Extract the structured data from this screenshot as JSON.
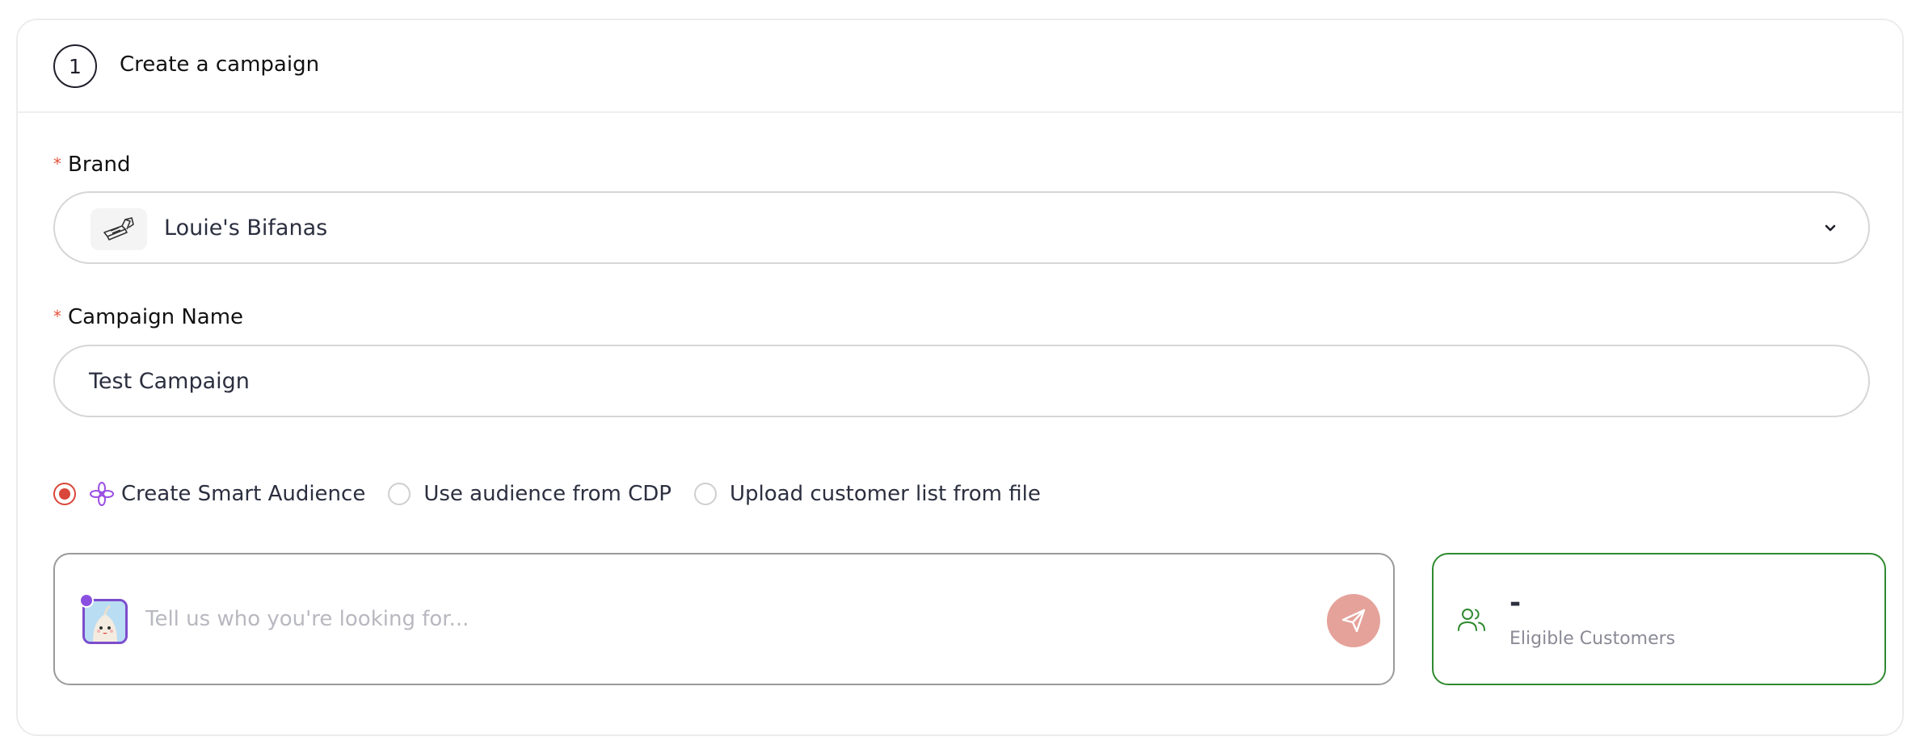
{
  "header": {
    "step_number": "1",
    "title": "Create a campaign"
  },
  "brand": {
    "label": "Brand",
    "required_mark": "*",
    "selected": "Louie's Bifanas",
    "logo_icon": "sandwich-logo-icon"
  },
  "campaign_name": {
    "label": "Campaign Name",
    "required_mark": "*",
    "value": "Test Campaign"
  },
  "audience_options": [
    {
      "label": "Create Smart Audience",
      "selected": true,
      "icon": "sparkle-icon"
    },
    {
      "label": "Use audience from CDP",
      "selected": false
    },
    {
      "label": "Upload customer list from file",
      "selected": false
    }
  ],
  "prompt": {
    "placeholder": "Tell us who you're looking for...",
    "send_icon": "send-icon"
  },
  "eligible": {
    "value": "-",
    "label": "Eligible Customers",
    "icon": "users-icon"
  },
  "colors": {
    "accent_red": "#d9463a",
    "send_button": "#e5a29a",
    "success_green": "#2f8a2f",
    "sparkle_purple": "#9b4fe3"
  }
}
